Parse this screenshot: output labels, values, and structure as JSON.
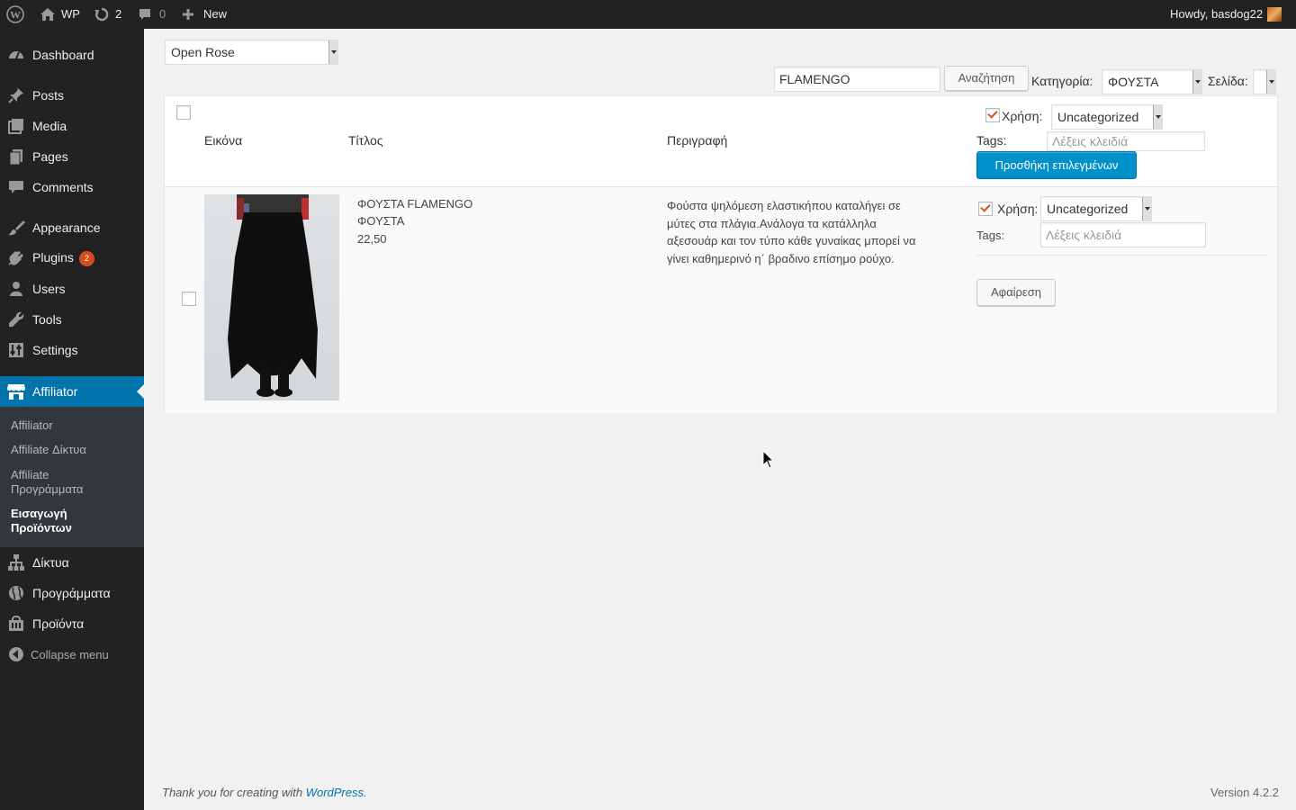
{
  "adminbar": {
    "site_name": "WP",
    "updates_count": "2",
    "comments_count": "0",
    "new_label": "New",
    "howdy": "Howdy, basdog22"
  },
  "sidebar": {
    "items": [
      {
        "label": "Dashboard",
        "icon": "dashboard-icon"
      },
      {
        "label": "Posts",
        "icon": "pin-icon"
      },
      {
        "label": "Media",
        "icon": "media-icon"
      },
      {
        "label": "Pages",
        "icon": "pages-icon"
      },
      {
        "label": "Comments",
        "icon": "comment-icon"
      },
      {
        "label": "Appearance",
        "icon": "brush-icon"
      },
      {
        "label": "Plugins",
        "icon": "plug-icon",
        "badge": "2"
      },
      {
        "label": "Users",
        "icon": "user-icon"
      },
      {
        "label": "Tools",
        "icon": "wrench-icon"
      },
      {
        "label": "Settings",
        "icon": "settings-icon"
      },
      {
        "label": "Affiliator",
        "icon": "store-icon"
      },
      {
        "label": "Δίκτυα",
        "icon": "network-icon"
      },
      {
        "label": "Προγράμματα",
        "icon": "globe-icon"
      },
      {
        "label": "Προϊόντα",
        "icon": "bag-icon"
      }
    ],
    "submenu": [
      "Affiliator",
      "Affiliate Δίκτυα",
      "Affiliate Προγράμματα",
      "Εισαγωγή Προϊόντων"
    ],
    "collapse_label": "Collapse menu"
  },
  "content": {
    "program_select": "Open Rose",
    "search_value": "FLAMENGO",
    "search_button": "Αναζήτηση",
    "category_label": "Κατηγορία:",
    "category_value": "ΦΟΥΣΤΑ",
    "page_label": "Σελίδα:",
    "page_value": ""
  },
  "table": {
    "headers": {
      "image": "Εικόνα",
      "title": "Τίτλος",
      "description": "Περιγραφή"
    },
    "bulk": {
      "use_label": "Χρήση:",
      "use_checked": true,
      "category_value": "Uncategorized",
      "tags_label": "Tags:",
      "tags_placeholder": "Λέξεις κλειδιά",
      "add_button": "Προσθήκη επιλεγμένων"
    },
    "rows": [
      {
        "title": "ΦΟΥΣΤΑ FLAMENGO",
        "category": "ΦΟΥΣΤΑ",
        "price": "22,50",
        "description": "Φούστα ψηλόμεση ελαστικήπου καταλήγει σε μύτες στα πλάγια.Ανάλογα τα κατάλληλα αξεσουάρ και τον τύπο κάθε γυναίκας μπορεί να γίνει καθημερινό η΄ βραδινο επίσημο ρούχο.",
        "description_lines": [
          "Φούστα ψηλόμεση ελαστικήπου καταλήγει σε",
          "μύτες στα πλάγια.Ανάλογα τα κατάλληλα",
          "αξεσουάρ και τον τύπο κάθε γυναίκας μπορεί να",
          "γίνει καθημερινό η΄ βραδινο επίσημο ρούχο."
        ],
        "use_label": "Χρήση:",
        "use_checked": true,
        "category_value": "Uncategorized",
        "tags_label": "Tags:",
        "tags_placeholder": "Λέξεις κλειδιά",
        "remove_button": "Αφαίρεση"
      }
    ]
  },
  "footer": {
    "thanks_text": "Thank you for creating with ",
    "wp_link": "WordPress",
    "period": ".",
    "version": "Version 4.2.2"
  },
  "colors": {
    "adminbar_bg": "#222222",
    "sidebar_bg": "#222222",
    "active_menu_bg": "#0073aa",
    "primary_button": "#0091cd",
    "badge": "#d54e21",
    "link": "#0073aa"
  }
}
